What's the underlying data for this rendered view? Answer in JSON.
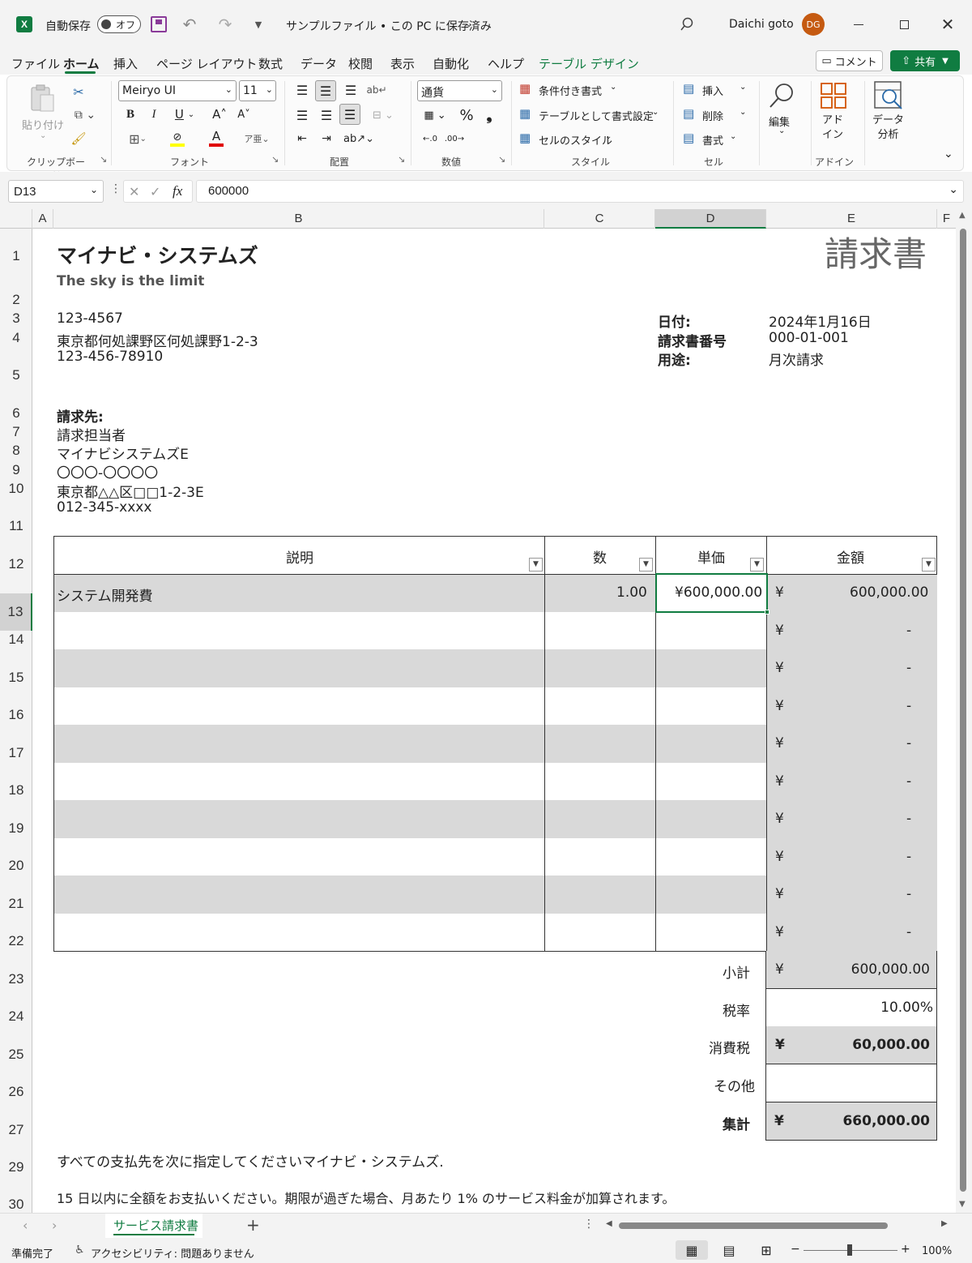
{
  "titlebar": {
    "autosave_label": "自動保存",
    "autosave_state": "オフ",
    "file_title": "サンプルファイル • この PC に保存済み",
    "user_name": "Daichi goto",
    "user_initials": "DG"
  },
  "menu": {
    "items": [
      "ファイル",
      "ホーム",
      "挿入",
      "ページ レイアウト",
      "数式",
      "データ",
      "校閲",
      "表示",
      "自動化",
      "ヘルプ",
      "テーブル デザイン"
    ],
    "comment_label": "コメント",
    "share_label": "共有"
  },
  "ribbon": {
    "paste_label": "貼り付け",
    "clipboard_group": "クリップボード",
    "font_name": "Meiryo UI",
    "font_size": "11",
    "font_group": "フォント",
    "align_group": "配置",
    "number_format": "通貨",
    "number_group": "数値",
    "cond_format": "条件付き書式",
    "table_format": "テーブルとして書式設定",
    "cell_styles": "セルのスタイル",
    "style_group": "スタイル",
    "insert_label": "挿入",
    "delete_label": "削除",
    "format_label": "書式",
    "cells_group": "セル",
    "edit_label": "編集",
    "addin_label": "アド\nイン",
    "addin_group": "アドイン",
    "data_analysis_label": "データ\n分析"
  },
  "formula_bar": {
    "name_box": "D13",
    "formula": "600000"
  },
  "columns": [
    "A",
    "B",
    "C",
    "D",
    "E",
    "F"
  ],
  "rows": [
    "1",
    "2",
    "3",
    "4",
    "5",
    "6",
    "7",
    "8",
    "9",
    "10",
    "11",
    "12",
    "13",
    "14",
    "15",
    "16",
    "17",
    "18",
    "19",
    "20",
    "21",
    "22",
    "23",
    "24",
    "25",
    "26",
    "27",
    "29",
    "30"
  ],
  "invoice": {
    "company": "マイナビ・システムズ",
    "slogan": "The sky is the limit",
    "doc_title": "請求書",
    "zip": "123-4567",
    "address": "東京都何処課野区何処課野1-2-3",
    "phone": "123-456-78910",
    "date_label": "日付:",
    "date_value": "2024年1月16日",
    "number_label": "請求書番号",
    "number_value": "000-01-001",
    "purpose_label": "用途:",
    "purpose_value": "月次請求",
    "bill_to_label": "請求先:",
    "bill_to": [
      "請求担当者",
      "マイナビシステムズE",
      "〇〇〇-〇〇〇〇",
      "東京都△△区□□1-2-3E",
      "012-345-xxxx"
    ],
    "headers": [
      "説明",
      "数",
      "単価",
      "金額"
    ],
    "item_desc": "システム開発費",
    "item_qty": "1.00",
    "item_price": "¥600,000.00",
    "currency": "¥",
    "item_amount": "600,000.00",
    "empty_amount": "-",
    "subtotal_label": "小計",
    "subtotal_value": "600,000.00",
    "tax_rate_label": "税率",
    "tax_rate_value": "10.00%",
    "tax_label": "消費税",
    "tax_value": "60,000.00",
    "other_label": "その他",
    "total_label": "集計",
    "total_value": "660,000.00",
    "footer1": "すべての支払先を次に指定してくださいマイナビ・システムズ.",
    "footer2": "15 日以内に全額をお支払いください。期限が過ぎた場合、月あたり 1% のサービス料金が加算されます。"
  },
  "sheet_tab": "サービス請求書",
  "status": {
    "ready": "準備完了",
    "accessibility": "アクセシビリティ: 問題ありません",
    "zoom": "100%"
  },
  "colors": {
    "excel_green": "#107c41",
    "band": "#d9d9d9",
    "avatar": "#c55a11"
  }
}
